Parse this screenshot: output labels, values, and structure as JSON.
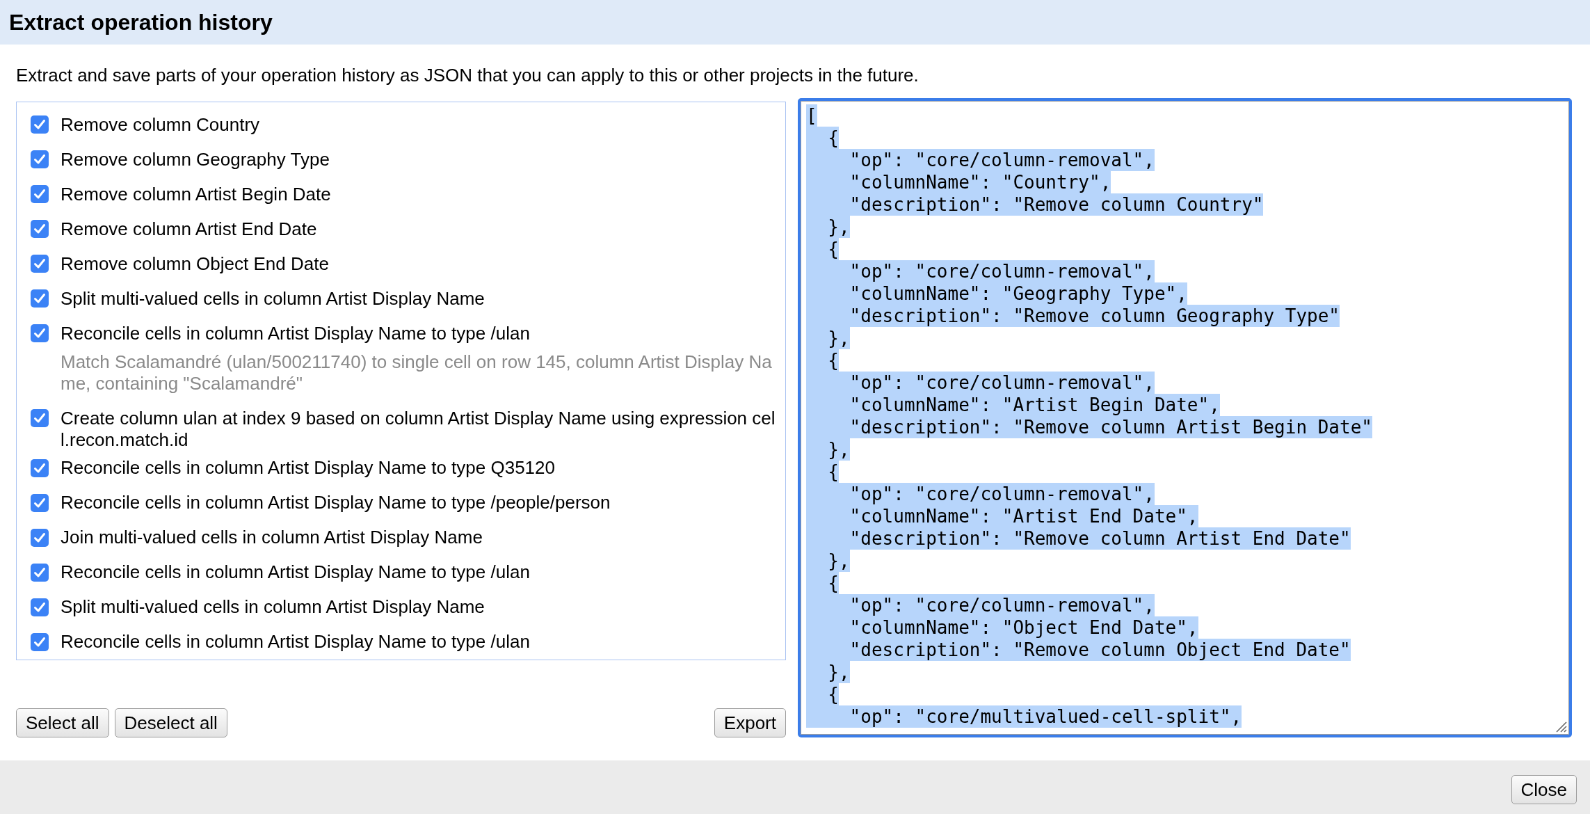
{
  "dialog": {
    "title": "Extract operation history"
  },
  "description": "Extract and save parts of your operation history as JSON that you can apply to this or other projects in the future.",
  "history": [
    {
      "kind": "operation",
      "label": "Remove column Country",
      "checked": true
    },
    {
      "kind": "operation",
      "label": "Remove column Geography Type",
      "checked": true
    },
    {
      "kind": "operation",
      "label": "Remove column Artist Begin Date",
      "checked": true
    },
    {
      "kind": "operation",
      "label": "Remove column Artist End Date",
      "checked": true
    },
    {
      "kind": "operation",
      "label": "Remove column Object End Date",
      "checked": true
    },
    {
      "kind": "operation",
      "label": "Split multi-valued cells in column Artist Display Name",
      "checked": true
    },
    {
      "kind": "operation",
      "label": "Reconcile cells in column Artist Display Name to type /ulan",
      "checked": true
    },
    {
      "kind": "note",
      "label": "Match Scalamandré (ulan/500211740) to single cell on row 145, column Artist Display Name, containing \"Scalamandré\""
    },
    {
      "kind": "operation",
      "label": "Create column ulan at index 9 based on column Artist Display Name using expression cell.recon.match.id",
      "checked": true
    },
    {
      "kind": "operation",
      "label": "Reconcile cells in column Artist Display Name to type Q35120",
      "checked": true
    },
    {
      "kind": "operation",
      "label": "Reconcile cells in column Artist Display Name to type /people/person",
      "checked": true
    },
    {
      "kind": "operation",
      "label": "Join multi-valued cells in column Artist Display Name",
      "checked": true
    },
    {
      "kind": "operation",
      "label": "Reconcile cells in column Artist Display Name to type /ulan",
      "checked": true
    },
    {
      "kind": "operation",
      "label": "Split multi-valued cells in column Artist Display Name",
      "checked": true
    },
    {
      "kind": "operation",
      "label": "Reconcile cells in column Artist Display Name to type /ulan",
      "checked": true
    }
  ],
  "select_all_button": {
    "label": "Select all"
  },
  "deselect_all_button": {
    "label": "Deselect all"
  },
  "export_button": {
    "label": "Export"
  },
  "json_output": {
    "value": "[\n  {\n    \"op\": \"core/column-removal\",\n    \"columnName\": \"Country\",\n    \"description\": \"Remove column Country\"\n  },\n  {\n    \"op\": \"core/column-removal\",\n    \"columnName\": \"Geography Type\",\n    \"description\": \"Remove column Geography Type\"\n  },\n  {\n    \"op\": \"core/column-removal\",\n    \"columnName\": \"Artist Begin Date\",\n    \"description\": \"Remove column Artist Begin Date\"\n  },\n  {\n    \"op\": \"core/column-removal\",\n    \"columnName\": \"Artist End Date\",\n    \"description\": \"Remove column Artist End Date\"\n  },\n  {\n    \"op\": \"core/column-removal\",\n    \"columnName\": \"Object End Date\",\n    \"description\": \"Remove column Object End Date\"\n  },\n  {\n    \"op\": \"core/multivalued-cell-split\",",
    "text_selected": true
  },
  "footer": {
    "close_button": {
      "label": "Close"
    }
  }
}
